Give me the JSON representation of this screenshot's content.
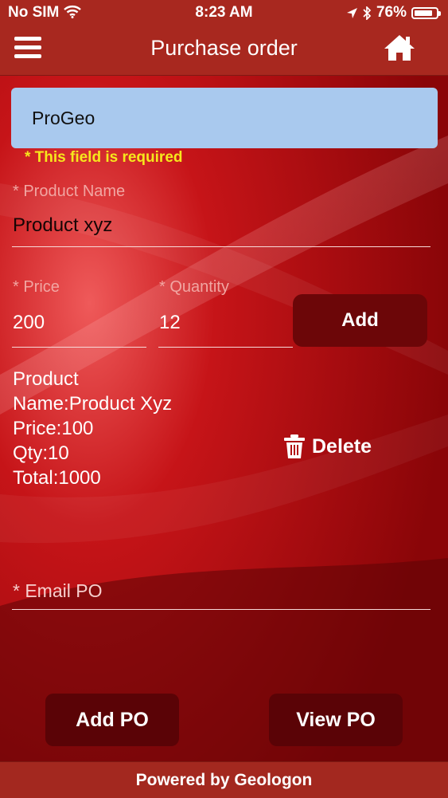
{
  "status_bar": {
    "carrier": "No SIM",
    "time": "8:23 AM",
    "battery": "76%",
    "battery_level": 0.76
  },
  "header": {
    "title": "Purchase order",
    "menu_icon": "menu-icon",
    "home_icon": "home-icon"
  },
  "form": {
    "company_value": "ProGeo",
    "required_message": "* This field is required",
    "product_name_label": "* Product Name",
    "product_name_value": "Product xyz",
    "price_label": "* Price",
    "price_value": "200",
    "quantity_label": "* Quantity",
    "quantity_value": "12",
    "add_label": "Add",
    "email_label": "* Email PO"
  },
  "product": {
    "line1": "Product",
    "line2": "Name:Product Xyz",
    "line3": "Price:100",
    "line4": "Qty:10",
    "line5": "Total:1000",
    "delete_label": "Delete",
    "delete_icon": "trash-icon"
  },
  "actions": {
    "add_po_label": "Add PO",
    "view_po_label": "View PO"
  },
  "footer": {
    "text": "Powered by Geologon"
  },
  "colors": {
    "background": "#b10d10",
    "bar": "#a8281f",
    "field": "#a9c9ee",
    "required": "#f6e71c",
    "button": "#6c0608"
  }
}
